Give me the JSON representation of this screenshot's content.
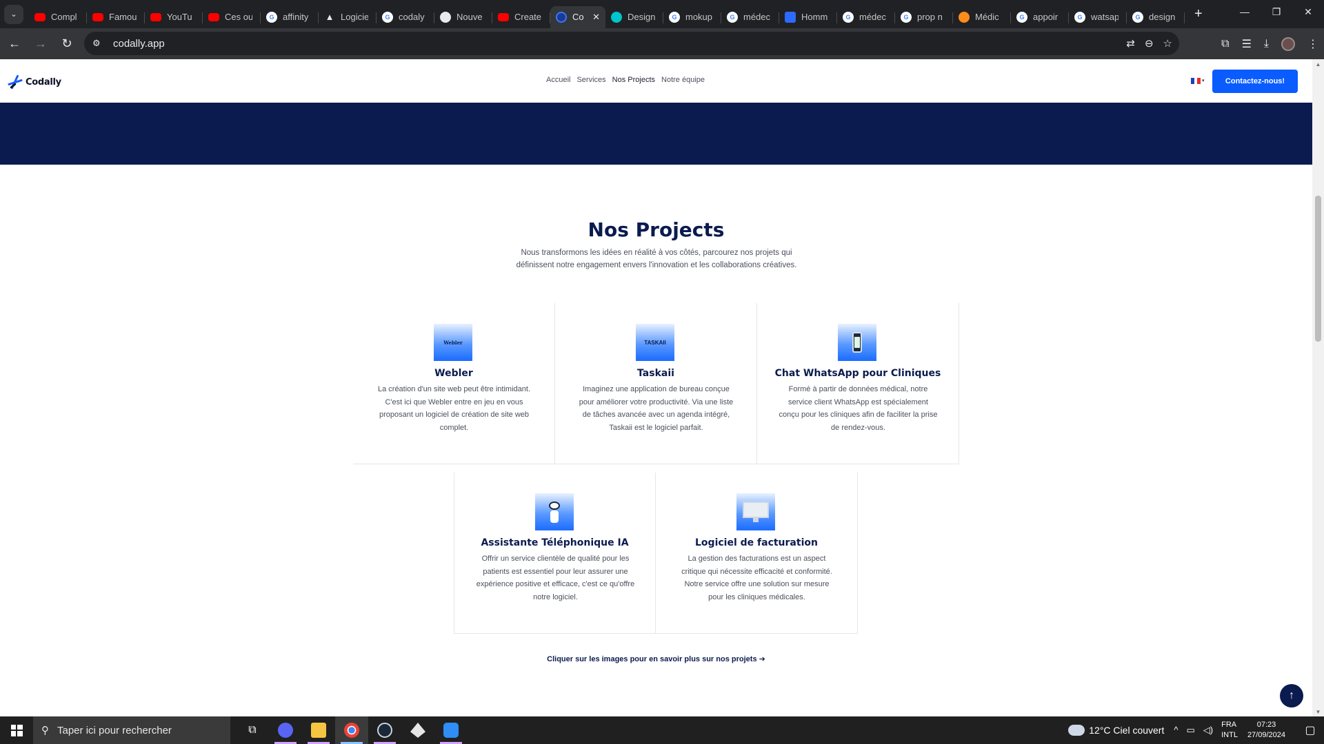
{
  "browser": {
    "tabs": [
      {
        "label": "Compl",
        "favicon": "youtube-icon"
      },
      {
        "label": "Famou",
        "favicon": "youtube-icon"
      },
      {
        "label": "YouTu",
        "favicon": "youtube-icon"
      },
      {
        "label": "Ces ou",
        "favicon": "youtube-icon"
      },
      {
        "label": "affinity",
        "favicon": "google-icon"
      },
      {
        "label": "Logicie",
        "favicon": "triangle-icon"
      },
      {
        "label": "codaly",
        "favicon": "google-icon"
      },
      {
        "label": "Nouve",
        "favicon": "github-icon"
      },
      {
        "label": "Create",
        "favicon": "youtube-icon"
      },
      {
        "label": "Co",
        "favicon": "codally-icon",
        "active": true
      },
      {
        "label": "Design",
        "favicon": "canva-icon"
      },
      {
        "label": "mokup",
        "favicon": "google-icon"
      },
      {
        "label": "médec",
        "favicon": "google-icon"
      },
      {
        "label": "Homm",
        "favicon": "form-icon"
      },
      {
        "label": "médec",
        "favicon": "google-icon"
      },
      {
        "label": "prop n",
        "favicon": "google-icon"
      },
      {
        "label": "Médic",
        "favicon": "medic-icon"
      },
      {
        "label": "appoir",
        "favicon": "google-icon"
      },
      {
        "label": "watsap",
        "favicon": "google-icon"
      },
      {
        "label": "design",
        "favicon": "google-icon"
      }
    ],
    "url": "codally.app"
  },
  "site": {
    "logo_text": "Codally",
    "menu": [
      "Accueil",
      "Services",
      "Nos Projects",
      "Notre équipe"
    ],
    "cta_label": "Contactez-nous!"
  },
  "projects": {
    "title": "Nos Projects",
    "subtitle": "Nous transformons les idées en réalité à vos côtés, parcourez nos projets qui définissent notre engagement envers l'innovation et les collaborations créatives.",
    "cards": [
      {
        "title": "Webler",
        "img_text": "Webler",
        "desc": "La création d'un site web peut être intimidant. C'est ici que Webler entre en jeu en vous proposant un logiciel de création de site web complet."
      },
      {
        "title": "Taskaii",
        "img_text": "TASKAII",
        "desc": "Imaginez une application de bureau conçue pour améliorer votre productivité. Via une liste de tâches avancée avec un agenda intégré, Taskaii est le logiciel parfait."
      },
      {
        "title": "Chat WhatsApp pour Cliniques",
        "img_text": "",
        "desc": "Formé à partir de données médical, notre service client WhatsApp est spécialement conçu pour les cliniques afin de faciliter la prise de rendez-vous."
      },
      {
        "title": "Assistante Téléphonique IA",
        "img_text": "",
        "desc": "Offrir un service clientèle de qualité pour les patients est essentiel pour leur assurer une expérience positive et efficace, c'est ce qu'offre notre logiciel."
      },
      {
        "title": "Logiciel de facturation",
        "img_text": "",
        "desc": "La gestion des facturations est un aspect critique qui nécessite efficacité et conformité. Notre service offre une solution sur mesure pour les cliniques médicales."
      }
    ],
    "hint": "Cliquer sur les images pour en savoir plus sur nos projets  ➔"
  },
  "taskbar": {
    "search_placeholder": "Taper ici pour rechercher",
    "weather": "12°C  Ciel couvert",
    "lang_1": "FRA",
    "lang_2": "INTL",
    "time": "07:23",
    "date": "27/09/2024"
  },
  "colors": {
    "accent": "#0a5cff",
    "navy": "#0b1b4f"
  }
}
